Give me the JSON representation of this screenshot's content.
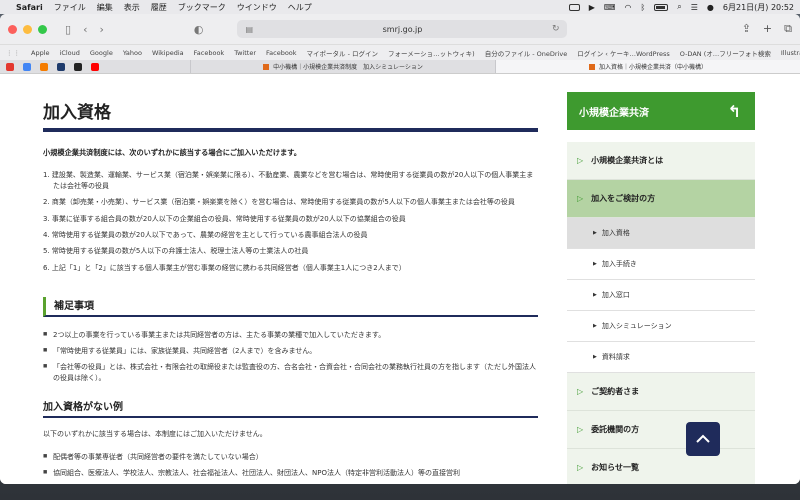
{
  "menubar": {
    "app": "Safari",
    "menus": [
      "ファイル",
      "編集",
      "表示",
      "履歴",
      "ブックマーク",
      "ウインドウ",
      "ヘルプ"
    ],
    "datetime": "6月21日(月)  20:52"
  },
  "browser": {
    "url": "smrj.go.jp",
    "favorites": [
      "Apple",
      "iCloud",
      "Google",
      "Yahoo",
      "Wikipedia",
      "Facebook",
      "Twitter",
      "Facebook",
      "マイポータル - ログイン",
      "フォーメーショ…ットウィキ)",
      "自分のファイル - OneDrive",
      "ログイン ‹ ケーキ…WordPress",
      "O-DAN (オ…フリーフォト検索",
      "Illustrations | unDraw"
    ],
    "tabs": [
      {
        "title": "中小機構｜小規模企業共済制度　加入シミュレーション",
        "active": false
      },
      {
        "title": "加入資格｜小規模企業共済（中小機構）",
        "active": true
      }
    ]
  },
  "main": {
    "title": "加入資格",
    "lead": "小規模企業共済制度には、次のいずれかに該当する場合にご加入いただけます。",
    "requirements": [
      "1. 建設業、製造業、運輸業、サービス業（宿泊業・娯楽業に限る）、不動産業、農業などを営む場合は、常時使用する従業員の数が20人以下の個人事業主または会社等の役員",
      "2. 商業（卸売業・小売業）、サービス業（宿泊業・娯楽業を除く）を営む場合は、常時使用する従業員の数が5人以下の個人事業主または会社等の役員",
      "3. 事業に従事する組合員の数が20人以下の企業組合の役員、常時使用する従業員の数が20人以下の協業組合の役員",
      "4. 常時使用する従業員の数が20人以下であって、農業の経営を主として行っている農事組合法人の役員",
      "5. 常時使用する従業員の数が5人以下の弁護士法人、税理士法人等の士業法人の社員",
      "6. 上記「1」と「2」に該当する個人事業主が営む事業の経営に携わる共同経営者（個人事業主1人につき2人まで）"
    ],
    "supplement_heading": "補足事項",
    "notes": [
      "2つ以上の事業を行っている事業主または共同経営者の方は、主たる事業の業種で加入していただきます。",
      "「常時使用する従業員」には、家族従業員、共同経営者（2人まで）を含みません。",
      "「会社等の役員」とは、株式会社・有限会社の取締役または監査役の方、合名会社・合資会社・合同会社の業務執行社員の方を指します（ただし外国法人の役員は除く）。"
    ],
    "ineligible_heading": "加入資格がない例",
    "ineligible_lead": "以下のいずれかに該当する場合は、本制度にはご加入いただけません。",
    "ineligible": [
      "配偶者等の事業専従者（共同経営者の要件を満たしていない場合）",
      "協同組合、医療法人、学校法人、宗教法人、社会福祉法人、社団法人、財団法人、NPO法人（特定非営利活動法人）等の直接営利"
    ]
  },
  "sidebar": {
    "header": "小規模企業共済",
    "items": [
      {
        "label": "小規模企業共済とは",
        "type": "main",
        "active": false
      },
      {
        "label": "加入をご検討の方",
        "type": "main",
        "active": true
      },
      {
        "label": "加入資格",
        "type": "sub",
        "active": true
      },
      {
        "label": "加入手続き",
        "type": "sub",
        "active": false
      },
      {
        "label": "加入窓口",
        "type": "sub",
        "active": false
      },
      {
        "label": "加入シミュレーション",
        "type": "sub",
        "active": false
      },
      {
        "label": "資料請求",
        "type": "sub",
        "active": false
      },
      {
        "label": "ご契約者さま",
        "type": "main",
        "active": false
      },
      {
        "label": "委託機関の方",
        "type": "main",
        "active": false
      },
      {
        "label": "お知らせ一覧",
        "type": "main",
        "active": false
      }
    ]
  },
  "colors": {
    "accent_green": "#3e9a2f",
    "navy": "#1f2b5b",
    "nav_active": "#b4d3a3"
  }
}
